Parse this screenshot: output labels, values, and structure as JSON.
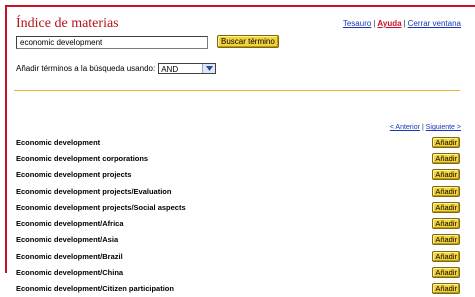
{
  "header": {
    "title": "Índice de materias",
    "links": [
      {
        "label": "Tesauro"
      },
      {
        "label": "Ayuda"
      },
      {
        "label": "Cerrar ventana"
      }
    ],
    "separator": "|"
  },
  "search": {
    "value": "economic development",
    "button_label": "Buscar término"
  },
  "combine": {
    "label": "Añadir términos a la búsqueda usando:",
    "selected": "AND"
  },
  "pager": {
    "prev_label": "< Anterior",
    "next_label": "Siguiente >",
    "separator": "|"
  },
  "results": {
    "add_label": "Añadir",
    "items": [
      "Economic development",
      "Economic development corporations",
      "Economic development projects",
      "Economic development projects/Evaluation",
      "Economic development projects/Social aspects",
      "Economic development/Africa",
      "Economic development/Asia",
      "Economic development/Brazil",
      "Economic development/China",
      "Economic development/Citizen participation"
    ]
  },
  "colors": {
    "accent_red": "#c8102e",
    "button_yellow": "#f4d23a",
    "link_blue": "#1a35b8"
  }
}
